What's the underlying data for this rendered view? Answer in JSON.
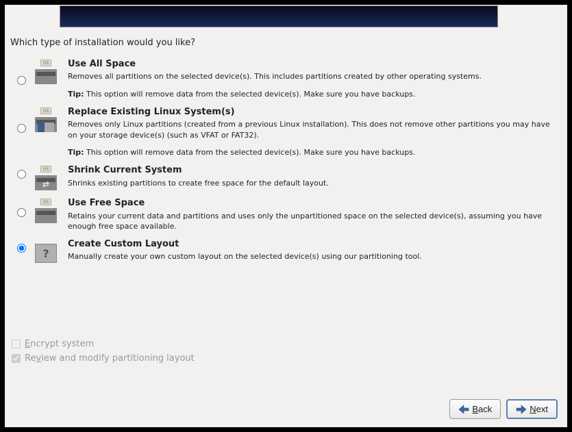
{
  "prompt": "Which type of installation would you like?",
  "options": {
    "use_all": {
      "title": "Use All Space",
      "desc": "Removes all partitions on the selected device(s).  This includes partitions created by other operating systems.",
      "tip_label": "Tip:",
      "tip": " This option will remove data from the selected device(s).  Make sure you have backups."
    },
    "replace": {
      "title": "Replace Existing Linux System(s)",
      "desc": "Removes only Linux partitions (created from a previous Linux installation).  This does not remove other partitions you may have on your storage device(s) (such as VFAT or FAT32).",
      "tip_label": "Tip:",
      "tip": " This option will remove data from the selected device(s).  Make sure you have backups."
    },
    "shrink": {
      "title": "Shrink Current System",
      "desc": "Shrinks existing partitions to create free space for the default layout."
    },
    "freespace": {
      "title": "Use Free Space",
      "desc": "Retains your current data and partitions and uses only the unpartitioned space on the selected device(s), assuming you have enough free space available."
    },
    "custom": {
      "title": "Create Custom Layout",
      "desc": "Manually create your own custom layout on the selected device(s) using our partitioning tool."
    }
  },
  "checkboxes": {
    "encrypt_pre": "E",
    "encrypt_post": "ncrypt system",
    "review_pre": "Re",
    "review_u": "v",
    "review_post": "iew and modify partitioning layout"
  },
  "buttons": {
    "back_u": "B",
    "back_rest": "ack",
    "next_u": "N",
    "next_rest": "ext"
  },
  "icon_labels": {
    "os": "OS",
    "q": "?"
  }
}
